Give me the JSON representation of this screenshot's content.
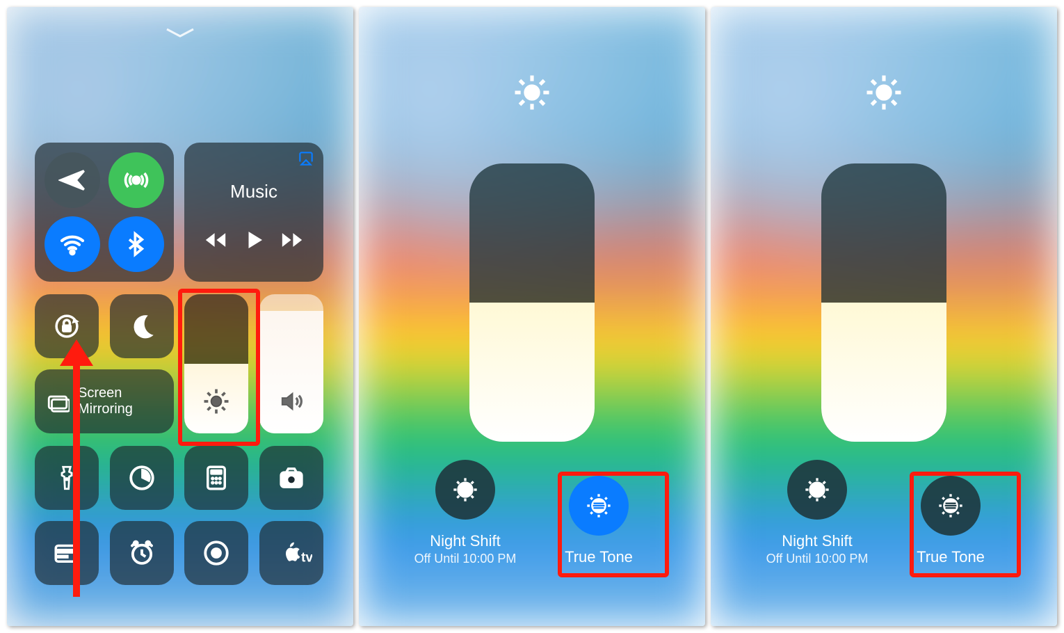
{
  "panel1": {
    "music_title": "Music",
    "mirror_label": "Screen\nMirroring",
    "brightness_level": 50,
    "volume_level": 88
  },
  "panel2": {
    "night_label": "Night Shift",
    "night_sub": "Off Until 10:00 PM",
    "tt_label": "True Tone",
    "tt_on": true,
    "brightness_level": 50
  },
  "panel3": {
    "night_label": "Night Shift",
    "night_sub": "Off Until 10:00 PM",
    "tt_label": "True Tone",
    "tt_on": false,
    "brightness_level": 50
  }
}
